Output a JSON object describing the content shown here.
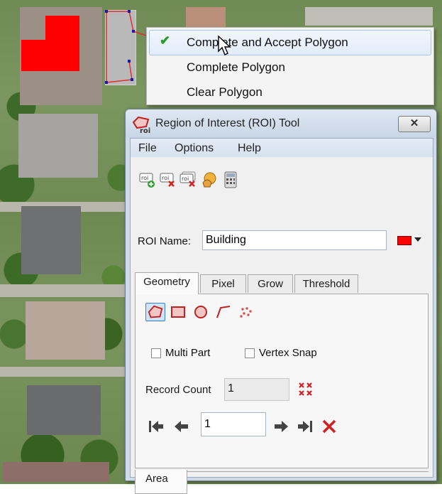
{
  "context_menu": {
    "items": [
      {
        "label": "Complete and Accept Polygon",
        "checked": true,
        "highlighted": true
      },
      {
        "label": "Complete Polygon"
      },
      {
        "label": "Clear Polygon"
      }
    ]
  },
  "window": {
    "title": "Region of Interest (ROI) Tool",
    "logo_text": "roi",
    "close_glyph": "✕"
  },
  "menu_bar": [
    "File",
    "Options",
    "Help"
  ],
  "toolbar": {
    "icons": [
      "new-roi-icon",
      "delete-roi-icon",
      "delete-all-roi-icon",
      "go-to-roi-icon",
      "calculator-icon"
    ],
    "roi_badge": "roi"
  },
  "roi_name": {
    "label": "ROI Name:",
    "value": "Building",
    "color": "#ff0000"
  },
  "tabs": [
    "Geometry",
    "Pixel",
    "Grow",
    "Threshold"
  ],
  "active_tab": "Geometry",
  "geometry": {
    "draw_tools": [
      "polygon-tool-icon",
      "rectangle-tool-icon",
      "ellipse-tool-icon",
      "polyline-tool-icon",
      "point-tool-icon"
    ],
    "selected_tool": "polygon-tool-icon",
    "multi_part": {
      "label": "Multi Part",
      "checked": false
    },
    "vertex_snap": {
      "label": "Vertex Snap",
      "checked": false
    },
    "record_count": {
      "label": "Record Count",
      "value": "1"
    },
    "record_index": "1"
  },
  "bottom_tabs": [
    "Area"
  ],
  "colors": {
    "accent_red": "#ff0000",
    "nav_delete": "#d42020",
    "check": "#2a9b2a"
  }
}
